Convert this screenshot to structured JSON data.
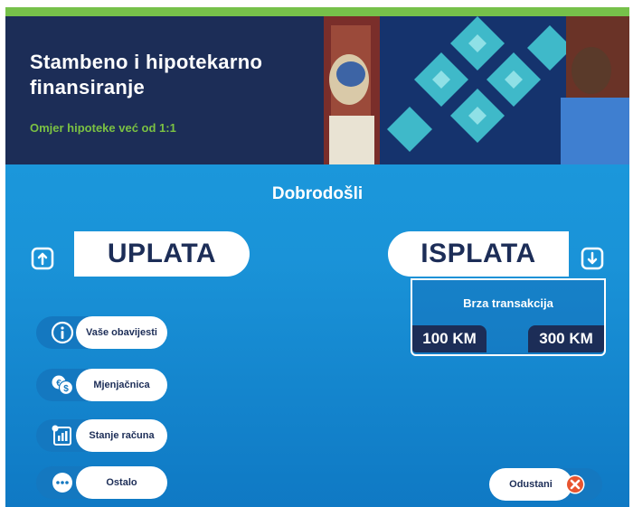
{
  "banner": {
    "title": "Stambeno i hipotekarno finansiranje",
    "subtitle": "Omjer hipoteke već od 1:1"
  },
  "welcome": "Dobrodošli",
  "deposit": {
    "label": "UPLATA",
    "icon": "upload-arrow-icon"
  },
  "withdraw": {
    "label": "ISPLATA",
    "icon": "download-arrow-icon"
  },
  "fast_transaction": {
    "title": "Brza transakcija",
    "amounts": [
      "100 KM",
      "300 KM"
    ]
  },
  "side_menu": [
    {
      "label": "Vaše obavijesti",
      "icon": "info-icon"
    },
    {
      "label": "Mjenjačnica",
      "icon": "currency-exchange-icon"
    },
    {
      "label": "Stanje računa",
      "icon": "account-balance-icon"
    },
    {
      "label": "Ostalo",
      "icon": "more-icon"
    }
  ],
  "cancel": {
    "label": "Odustani",
    "icon": "close-icon"
  },
  "colors": {
    "navy": "#1c2d57",
    "blue": "#1d9ee0",
    "green": "#76c14a",
    "cancel_red": "#e8542f"
  }
}
